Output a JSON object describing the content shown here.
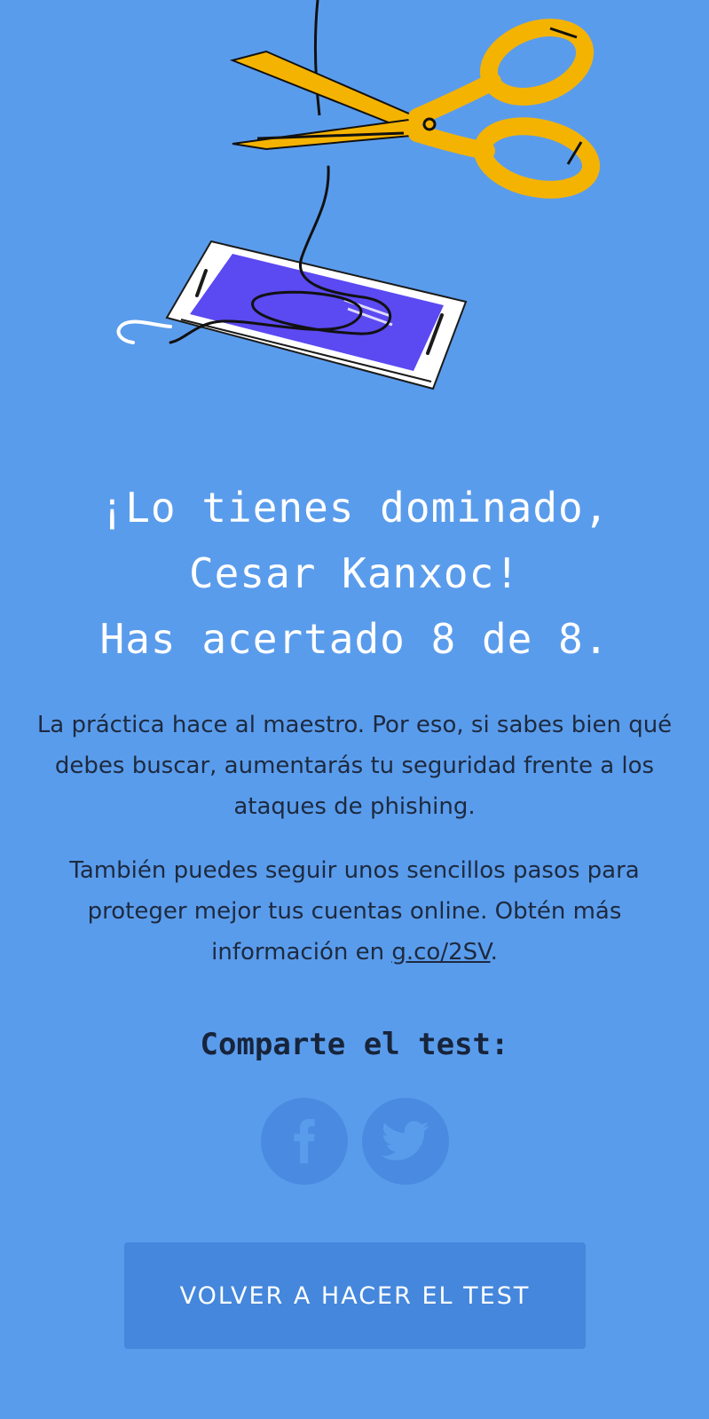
{
  "colors": {
    "background": "#5a9cec",
    "headline_text": "#ffffff",
    "body_text": "#1d2a3f",
    "social_circle": "#4a8ae0",
    "button_background": "#4487dc",
    "scissors": "#f5b301",
    "phone_screen": "#5b49f2"
  },
  "result": {
    "headline_line1": "¡Lo tienes dominado,",
    "headline_line2": "Cesar Kanxoc!",
    "headline_line3": "Has acertado 8 de 8."
  },
  "content": {
    "paragraph1": "La práctica hace al maestro. Por eso, si sabes bien qué debes buscar, aumentarás tu seguridad frente a los ataques de phishing.",
    "paragraph2_prefix": "También puedes seguir unos sencillos pasos para proteger mejor tus cuentas online. Obtén más información en ",
    "paragraph2_link": "g.co/2SV",
    "paragraph2_suffix": "."
  },
  "share": {
    "title": "Comparte el test:",
    "icons": [
      "facebook-icon",
      "twitter-icon"
    ]
  },
  "actions": {
    "retry_label": "VOLVER A HACER EL TEST"
  },
  "illustration": {
    "icons": [
      "scissors-icon",
      "smartphone-icon",
      "cut-cable-icon"
    ]
  }
}
